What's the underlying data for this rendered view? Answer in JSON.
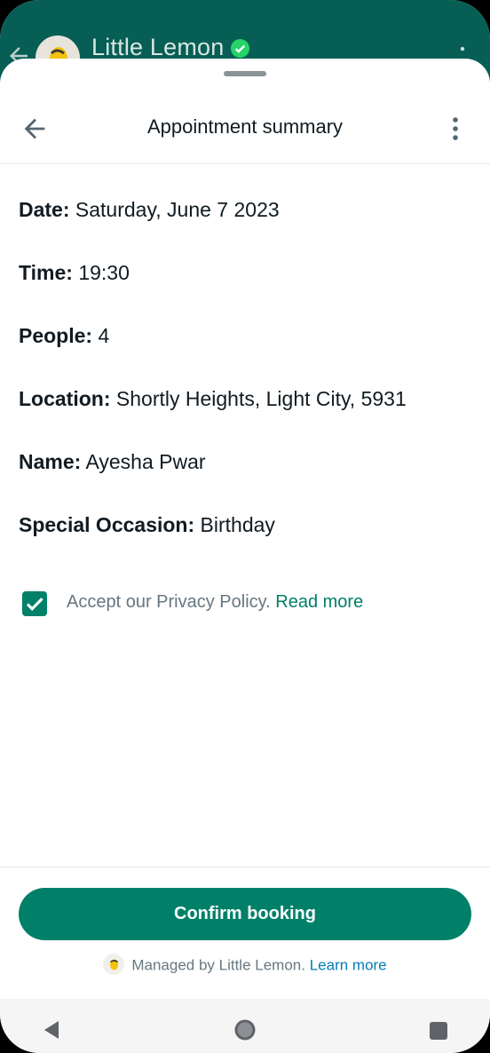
{
  "background_chat": {
    "title": "Little Lemon",
    "icons": [
      "back-arrow-icon",
      "lemon-avatar",
      "verified-badge-icon",
      "more-vert-icon"
    ]
  },
  "sheet": {
    "title": "Appointment summary",
    "icons": [
      "back-arrow-icon",
      "more-vert-icon"
    ]
  },
  "details": [
    {
      "label": "Date:",
      "value": "Saturday, June 7 2023"
    },
    {
      "label": "Time:",
      "value": "19:30"
    },
    {
      "label": "People:",
      "value": "4"
    },
    {
      "label": "Location:",
      "value": "Shortly Heights, Light City, 5931"
    },
    {
      "label": "Name:",
      "value": "Ayesha Pwar"
    },
    {
      "label": "Special Occasion:",
      "value": "Birthday"
    }
  ],
  "consent": {
    "checked": true,
    "text": "Accept our Privacy Policy.",
    "link": "Read more"
  },
  "footer": {
    "confirm_label": "Confirm booking",
    "managed_text": "Managed by Little Lemon.",
    "managed_link": "Learn more"
  },
  "colors": {
    "accent": "#008069",
    "header_bg": "#075e54",
    "link_blue": "#027eb5",
    "text": "#111b21",
    "muted": "#667781"
  }
}
